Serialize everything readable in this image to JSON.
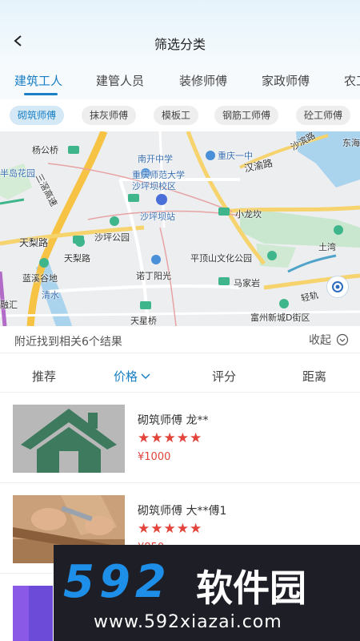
{
  "header": {
    "title": "筛选分类"
  },
  "tabs": [
    "建筑工人",
    "建管人员",
    "装修师傅",
    "家政师傅",
    "农工"
  ],
  "chips": [
    "砌筑师傅",
    "抹灰师傅",
    "模板工",
    "钢筋工师傅",
    "砼工师傅"
  ],
  "map": {
    "labels": [
      "杨公桥",
      "半岛花园",
      "南开中学",
      "重庆一中",
      "沙滨路",
      "东海",
      "重庆师范大学",
      "沙坪坝校区",
      "汉渝路",
      "三滘高速",
      "沙坪坝站",
      "小龙坎",
      "天梨路",
      "沙坪公园",
      "土湾",
      "天梨路",
      "蓝溪谷地",
      "诺丁阳光",
      "平顶山文化公园",
      "马家岩",
      "清水",
      "轻轨",
      "融汇",
      "天星桥",
      "富州新城D街区"
    ]
  },
  "result": {
    "text": "附近找到相关6个结果",
    "collapse_label": "收起"
  },
  "sort": {
    "items": [
      "推荐",
      "价格",
      "评分",
      "距离"
    ]
  },
  "list": [
    {
      "name": "砌筑师傅 龙**",
      "rating": 5,
      "stars": "★★★★★",
      "price": "¥1000"
    },
    {
      "name": "砌筑师傅 大**傅1",
      "rating": 5,
      "stars": "★★★★★",
      "price": "¥850"
    }
  ],
  "watermark": {
    "logo": "592",
    "brand": "软件园",
    "url": "www.592xiazai.com"
  },
  "colors": {
    "accent": "#1a7fc4",
    "price": "#e2433b",
    "chip_active_bg": "#d5e8f6",
    "watermark_blue": "#1e8fe8"
  }
}
